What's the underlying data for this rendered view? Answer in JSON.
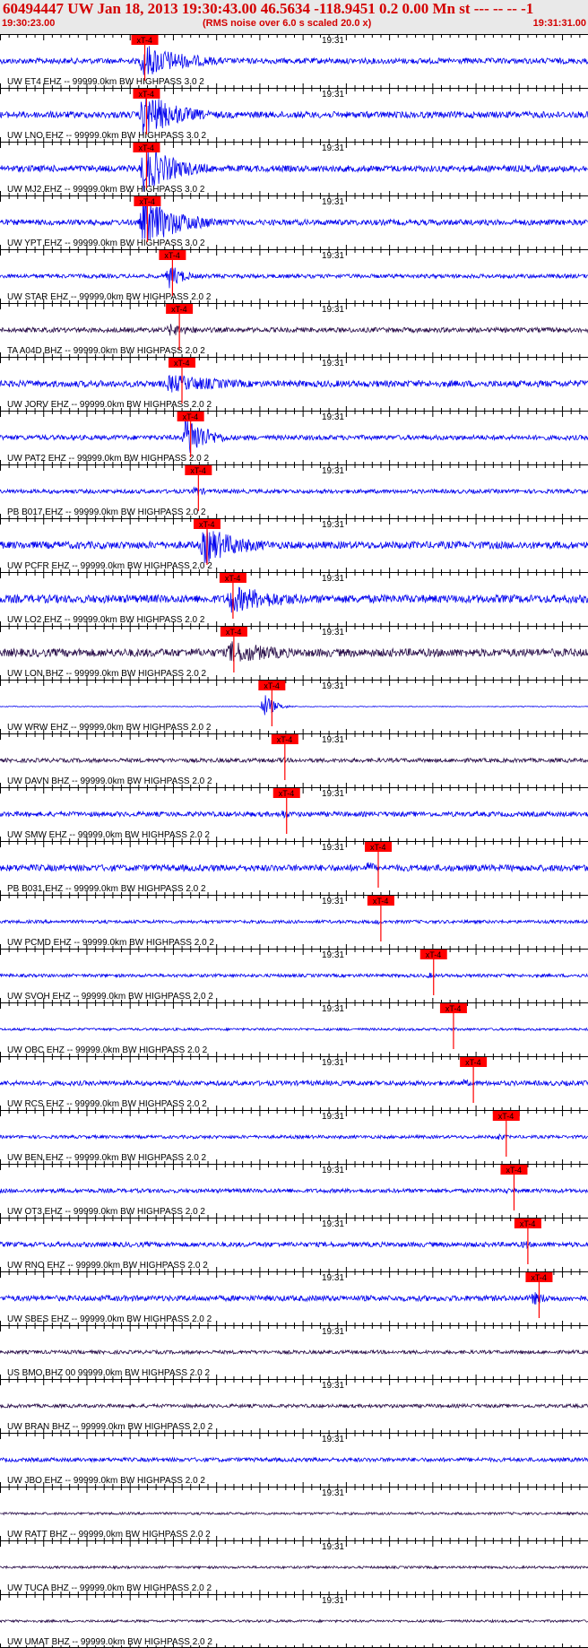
{
  "header": {
    "title": "60494447 UW Jan 18, 2013 19:30:43.00   46.5634 -118.9451  0.2 0.00 Mn st --- -- --   -1",
    "start_time": "19:30:23.00",
    "scale_note": "(RMS noise over 6.0 s scaled 20.0 x)",
    "end_time": "19:31:31.00"
  },
  "colors": {
    "header_text": "#d40000",
    "header_bg": "#e9e9e9",
    "trace_blue": "#0000ee",
    "trace_dark": "#2a0f4a",
    "pick": "#ff0000",
    "axis": "#000000"
  },
  "chart_data": {
    "type": "line",
    "title": "",
    "x_unit": "time",
    "x_start": "19:30:23.00",
    "x_end": "19:31:31.00",
    "minute_label": "19:31",
    "minute_mark": "19:31:00",
    "pick_label": "xT-4",
    "traces": [
      {
        "label": "UW ET4 EHZ -- 99999.0km BW  HIGHPASS  3.0  2",
        "color": "blue",
        "pick_s": 15.5,
        "burst": [
          16,
          25
        ],
        "amp": 2.2,
        "noise": 0.35
      },
      {
        "label": "UW LNO EHZ -- 99999.0km BW  HIGHPASS  3.0  2",
        "color": "blue",
        "pick_s": 15.7,
        "burst": [
          16,
          23
        ],
        "amp": 3.0,
        "noise": 0.4
      },
      {
        "label": "UW MJ2 EHZ -- 99999.0km BW  HIGHPASS  3.0  2",
        "color": "blue",
        "pick_s": 15.7,
        "burst": [
          16,
          23
        ],
        "amp": 3.0,
        "noise": 0.4
      },
      {
        "label": "UW YPT EHZ -- 99999.0km BW  HIGHPASS  3.0  2",
        "color": "blue",
        "pick_s": 15.8,
        "burst": [
          16,
          24
        ],
        "amp": 3.0,
        "noise": 0.35
      },
      {
        "label": "UW STAR EHZ -- 99999.0km BW  HIGHPASS  2.0  2",
        "color": "blue",
        "pick_s": 18.7,
        "burst": [
          19,
          22
        ],
        "amp": 1.6,
        "noise": 0.25
      },
      {
        "label": "TA A04D BHZ -- 99999.0km BW  HIGHPASS  2.0  2",
        "color": "dark",
        "pick_s": 19.5,
        "burst": [
          19,
          26
        ],
        "amp": 0.8,
        "noise": 0.3
      },
      {
        "label": "UW JORV EHZ -- 99999.0km BW  HIGHPASS  2.0  2",
        "color": "blue",
        "pick_s": 19.8,
        "burst": [
          19,
          33
        ],
        "amp": 1.2,
        "noise": 0.4
      },
      {
        "label": "UW PAT2 EHZ -- 99999.0km BW  HIGHPASS  2.0  2",
        "color": "blue",
        "pick_s": 20.8,
        "burst": [
          21,
          25
        ],
        "amp": 3.0,
        "noise": 0.3
      },
      {
        "label": "PB B017 EHZ -- 99999.0km BW  HIGHPASS  2.0  2",
        "color": "blue",
        "pick_s": 21.7,
        "burst": [
          22,
          24
        ],
        "amp": 0.8,
        "noise": 0.25
      },
      {
        "label": "UW PCFR EHZ -- 99999.0km BW  HIGHPASS  2.0  2",
        "color": "blue",
        "pick_s": 22.7,
        "burst": [
          23,
          31
        ],
        "amp": 2.4,
        "noise": 0.45
      },
      {
        "label": "UW LO2 EHZ -- 99999.0km BW  HIGHPASS  2.0  2",
        "color": "blue",
        "pick_s": 25.7,
        "burst": [
          26,
          38
        ],
        "amp": 1.8,
        "noise": 0.5
      },
      {
        "label": "UW LON BHZ -- 99999.0km BW  HIGHPASS  2.0  2",
        "color": "dark",
        "pick_s": 25.8,
        "burst": [
          26,
          38
        ],
        "amp": 1.5,
        "noise": 0.5
      },
      {
        "label": "UW WRW EHZ -- 99999.0km BW  HIGHPASS  2.0  2",
        "color": "blue",
        "pick_s": 30.2,
        "burst": [
          30,
          32
        ],
        "amp": 1.6,
        "noise": 0.05
      },
      {
        "label": "UW DAVN BHZ -- 99999.0km BW  HIGHPASS  2.0  2",
        "color": "dark",
        "pick_s": 31.7,
        "burst": [
          32,
          34
        ],
        "amp": 0.5,
        "noise": 0.25
      },
      {
        "label": "UW SMW EHZ -- 99999.0km BW  HIGHPASS  2.0  2",
        "color": "blue",
        "pick_s": 31.9,
        "burst": [
          32,
          34
        ],
        "amp": 0.7,
        "noise": 0.3
      },
      {
        "label": "PB B031 EHZ -- 99999.0km BW  HIGHPASS  2.0  2",
        "color": "blue",
        "pick_s": 42.5,
        "burst": [
          42,
          44
        ],
        "amp": 0.9,
        "noise": 0.4
      },
      {
        "label": "UW PCMD EHZ -- 99999.0km BW  HIGHPASS  2.0  2",
        "color": "blue",
        "pick_s": 42.8,
        "burst": [
          43,
          44
        ],
        "amp": 0.4,
        "noise": 0.2
      },
      {
        "label": "UW SVOH EHZ -- 99999.0km BW  HIGHPASS  2.0  2",
        "color": "blue",
        "pick_s": 48.9,
        "burst": [
          49,
          51
        ],
        "amp": 0.4,
        "noise": 0.2
      },
      {
        "label": "UW OBC EHZ -- 99999.0km BW  HIGHPASS  2.0  2",
        "color": "blue",
        "pick_s": 51.2,
        "burst": [
          51,
          53
        ],
        "amp": 0.3,
        "noise": 0.15
      },
      {
        "label": "UW RCS EHZ -- 99999.0km BW  HIGHPASS  2.0  2",
        "color": "blue",
        "pick_s": 53.5,
        "burst": [
          53,
          56
        ],
        "amp": 0.5,
        "noise": 0.3
      },
      {
        "label": "UW BEN EHZ -- 99999.0km BW  HIGHPASS  2.0  2",
        "color": "blue",
        "pick_s": 57.3,
        "burst": [
          57,
          59
        ],
        "amp": 0.5,
        "noise": 0.2
      },
      {
        "label": "UW OT3 EHZ -- 99999.0km BW  HIGHPASS  2.0  2",
        "color": "blue",
        "pick_s": 58.2,
        "burst": [
          58,
          60
        ],
        "amp": 0.4,
        "noise": 0.25
      },
      {
        "label": "UW RNO EHZ -- 99999.0km BW  HIGHPASS  2.0  2",
        "color": "blue",
        "pick_s": 59.8,
        "burst": [
          60,
          62
        ],
        "amp": 0.6,
        "noise": 0.3
      },
      {
        "label": "UW SBES EHZ -- 99999.0km BW  HIGHPASS  2.0  2",
        "color": "blue",
        "pick_s": 61.1,
        "burst": [
          61,
          65
        ],
        "amp": 0.9,
        "noise": 0.35
      },
      {
        "label": "US BMO BHZ 00 99999.0km BW  HIGHPASS  2.0  2",
        "color": "dark",
        "pick_s": null,
        "burst": null,
        "amp": 0,
        "noise": 0.22
      },
      {
        "label": "UW BRAN BHZ -- 99999.0km BW  HIGHPASS  2.0  2",
        "color": "dark",
        "pick_s": null,
        "burst": null,
        "amp": 0,
        "noise": 0.22
      },
      {
        "label": "UW JBO EHZ -- 99999.0km BW  HIGHPASS  2.0  2",
        "color": "blue",
        "pick_s": null,
        "burst": null,
        "amp": 0,
        "noise": 0.25
      },
      {
        "label": "UW RATT BHZ -- 99999.0km BW  HIGHPASS  2.0  2",
        "color": "dark",
        "pick_s": null,
        "burst": null,
        "amp": 0,
        "noise": 0.15
      },
      {
        "label": "UW TUCA BHZ -- 99999.0km BW  HIGHPASS  2.0  2",
        "color": "dark",
        "pick_s": null,
        "burst": null,
        "amp": 0,
        "noise": 0.15
      },
      {
        "label": "UW UMAT BHZ -- 99999.0km BW  HIGHPASS  2.0  2",
        "color": "dark",
        "pick_s": null,
        "burst": null,
        "amp": 0,
        "noise": 0.15
      }
    ]
  }
}
